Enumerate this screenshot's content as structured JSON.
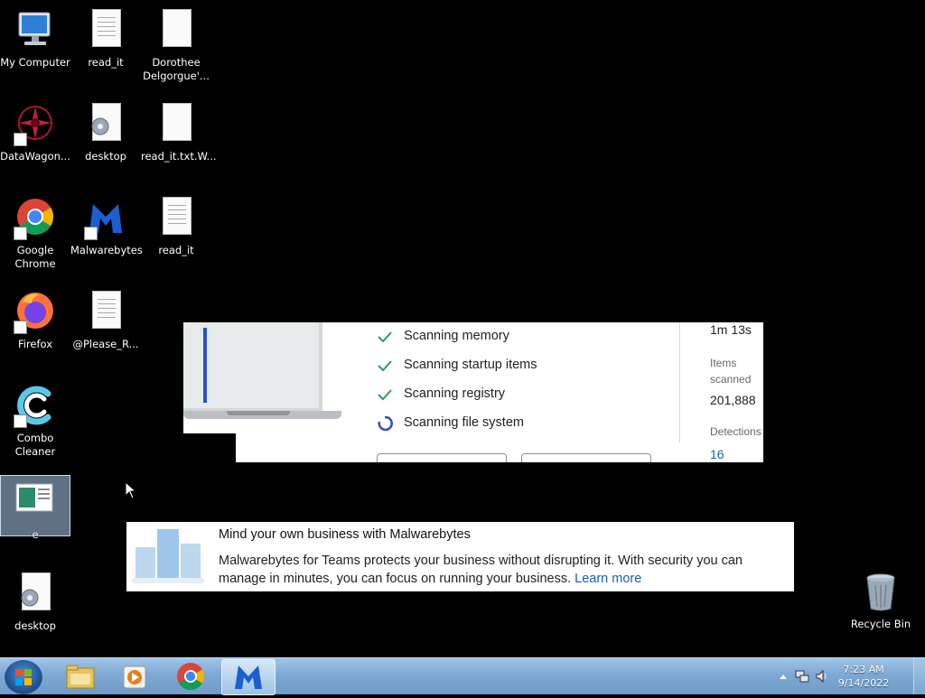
{
  "desktop": {
    "icons": [
      {
        "label": "My Computer"
      },
      {
        "label": "read_it"
      },
      {
        "label": "Dorothee Delgorgue'..."
      },
      {
        "label": "DataWagon..."
      },
      {
        "label": "desktop"
      },
      {
        "label": "read_it.txt.W..."
      },
      {
        "label": "Google Chrome"
      },
      {
        "label": "Malwarebytes"
      },
      {
        "label": "read_it"
      },
      {
        "label": "Firefox"
      },
      {
        "label": "@Please_R..."
      },
      {
        "label": "Combo Cleaner"
      },
      {
        "label": "e"
      },
      {
        "label": "desktop"
      },
      {
        "label": "Recycle Bin"
      }
    ]
  },
  "scan_panel": {
    "steps": [
      {
        "label": "Scanning memory",
        "status": "done"
      },
      {
        "label": "Scanning startup items",
        "status": "done"
      },
      {
        "label": "Scanning registry",
        "status": "done"
      },
      {
        "label": "Scanning file system",
        "status": "in-progress"
      }
    ],
    "elapsed": "1m 13s",
    "items_scanned_label": "Items scanned",
    "items_scanned_value": "201,888",
    "detections_label": "Detections",
    "detections_value": "16",
    "colors": {
      "check": "#2e9e5a",
      "spinner": "#2c4fc9",
      "accent": "#1a5fb4"
    }
  },
  "banner": {
    "title": "Mind your own business with Malwarebytes",
    "body": "Malwarebytes for Teams protects your business without disrupting it. With security you can manage in minutes, you can focus on running your business.",
    "link": "Learn more"
  },
  "taskbar": {
    "items": [
      {
        "icon": "windows-explorer-icon"
      },
      {
        "icon": "media-player-icon"
      },
      {
        "icon": "chrome-icon"
      },
      {
        "icon": "malwarebytes-icon",
        "active": true
      }
    ],
    "clock_time": "7:23 AM",
    "clock_date": "9/14/2022"
  }
}
